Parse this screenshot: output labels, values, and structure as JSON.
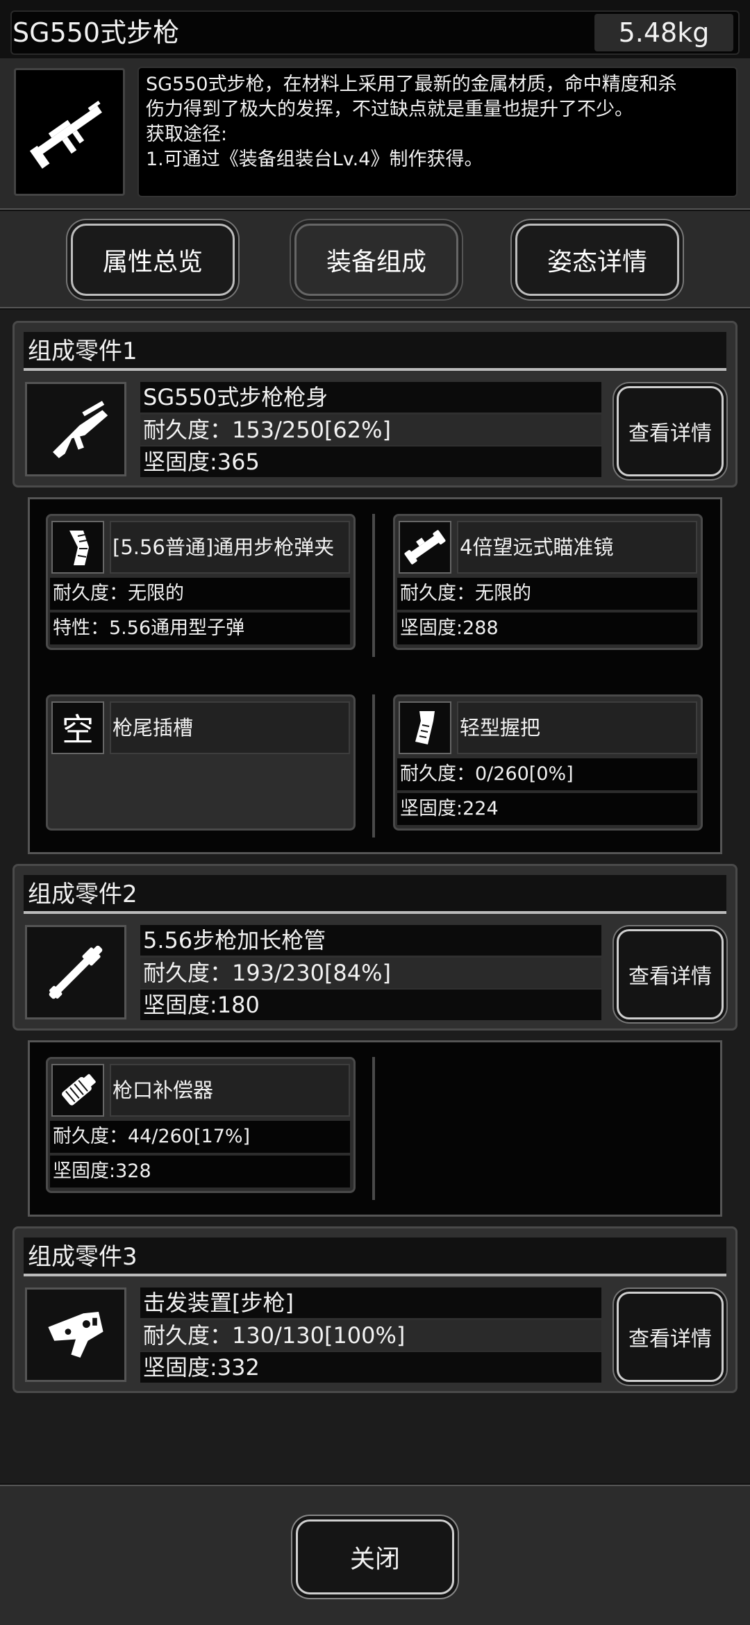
{
  "item": {
    "title": "SG550式步枪",
    "weight": "5.48kg",
    "description_lines": [
      "SG550式步枪，在材料上采用了最新的金属材质，命中精度和杀",
      "伤力得到了极大的发挥，不过缺点就是重量也提升了不少。",
      "获取途径:",
      "1.可通过《装备组装台Lv.4》制作获得。"
    ]
  },
  "tabs": [
    {
      "label": "属性总览"
    },
    {
      "label": "装备组成"
    },
    {
      "label": "姿态详情"
    }
  ],
  "parts": [
    {
      "header": "组成零件1",
      "name": "SG550式步枪枪身",
      "durability": "耐久度：153/250[62%]",
      "firmness": "坚固度:365",
      "detail_label": "查看详情",
      "icon": "rifle-body-icon",
      "subparts": [
        {
          "name": "[5.56普通]通用步枪弹夹",
          "line1": "耐久度：无限的",
          "line2": "特性：5.56通用型子弹",
          "icon": "magazine-icon"
        },
        {
          "name": "4倍望远式瞄准镜",
          "line1": "耐久度：无限的",
          "line2": "坚固度:288",
          "icon": "scope-icon"
        },
        {
          "name": "枪尾插槽",
          "empty_glyph": "空",
          "icon": "empty-slot-icon"
        },
        {
          "name": "轻型握把",
          "line1": "耐久度：0/260[0%]",
          "line2": "坚固度:224",
          "icon": "grip-icon"
        }
      ]
    },
    {
      "header": "组成零件2",
      "name": "5.56步枪加长枪管",
      "durability": "耐久度：193/230[84%]",
      "firmness": "坚固度:180",
      "detail_label": "查看详情",
      "icon": "barrel-icon",
      "subparts": [
        {
          "name": "枪口补偿器",
          "line1": "耐久度：44/260[17%]",
          "line2": "坚固度:328",
          "icon": "compensator-icon"
        }
      ]
    },
    {
      "header": "组成零件3",
      "name": "击发装置[步枪]",
      "durability": "耐久度：130/130[100%]",
      "firmness": "坚固度:332",
      "detail_label": "查看详情",
      "icon": "trigger-icon"
    }
  ],
  "footer": {
    "close_label": "关闭"
  }
}
